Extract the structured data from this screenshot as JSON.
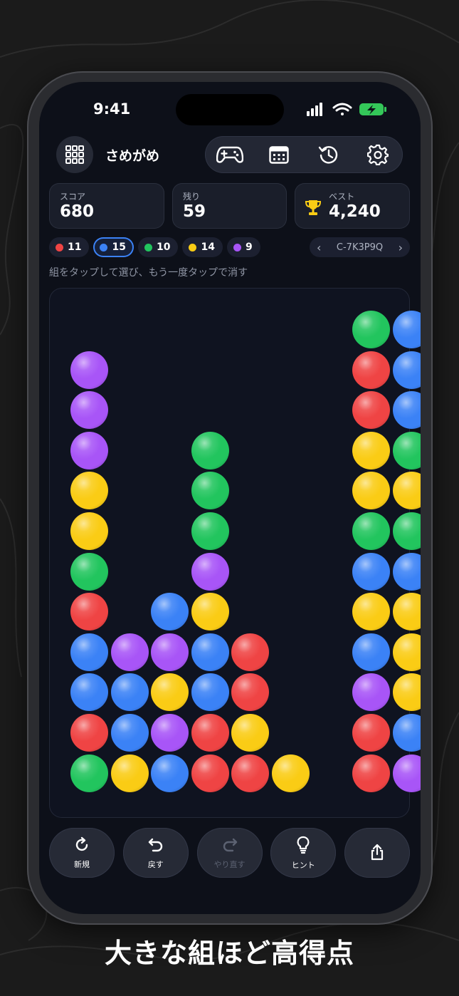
{
  "status": {
    "time": "9:41"
  },
  "header": {
    "title": "さめがめ",
    "icons": [
      "grid-icon",
      "gamepad-icon",
      "calendar-icon",
      "history-icon",
      "gear-icon"
    ]
  },
  "stats": {
    "score": {
      "label": "スコア",
      "value": "680"
    },
    "remaining": {
      "label": "残り",
      "value": "59"
    },
    "best": {
      "label": "ベスト",
      "value": "4,240"
    }
  },
  "colors": {
    "red": "#ef4444",
    "blue": "#3b82f6",
    "green": "#22c55e",
    "yellow": "#facc15",
    "purple": "#a855f7"
  },
  "chips": [
    {
      "color": "red",
      "count": "11",
      "active": false
    },
    {
      "color": "blue",
      "count": "15",
      "active": true
    },
    {
      "color": "green",
      "count": "10",
      "active": false
    },
    {
      "color": "yellow",
      "count": "14",
      "active": false
    },
    {
      "color": "purple",
      "count": "9",
      "active": false
    }
  ],
  "seed": {
    "code": "C-7K3P9Q"
  },
  "hint_text": "組をタップして選び、もう一度タップで消す",
  "board": {
    "rows": 12,
    "columns": [
      [
        "green",
        "red",
        "blue",
        "blue",
        "red",
        "green",
        "yellow",
        "yellow",
        "purple",
        "purple",
        "purple"
      ],
      [
        "yellow",
        "blue",
        "blue",
        "purple"
      ],
      [
        "blue",
        "purple",
        "yellow",
        "purple",
        "blue"
      ],
      [
        "red",
        "red",
        "blue",
        "blue",
        "yellow",
        "purple",
        "green",
        "green",
        "green"
      ],
      [
        "red",
        "yellow",
        "red",
        "red"
      ],
      [
        "yellow"
      ],
      [],
      [
        "red",
        "red",
        "purple",
        "blue",
        "yellow",
        "blue",
        "green",
        "yellow",
        "yellow",
        "red",
        "red",
        "green"
      ],
      [
        "purple",
        "blue",
        "yellow",
        "yellow",
        "yellow",
        "blue",
        "green",
        "yellow",
        "green",
        "blue",
        "blue",
        "blue"
      ]
    ]
  },
  "actions": [
    {
      "label": "新規",
      "icon": "refresh-icon",
      "enabled": true
    },
    {
      "label": "戻す",
      "icon": "undo-icon",
      "enabled": true
    },
    {
      "label": "やり直す",
      "icon": "redo-icon",
      "enabled": false
    },
    {
      "label": "ヒント",
      "icon": "lightbulb-icon",
      "enabled": true
    },
    {
      "label": "",
      "icon": "share-icon",
      "enabled": true
    }
  ],
  "caption": "大きな組ほど高得点"
}
